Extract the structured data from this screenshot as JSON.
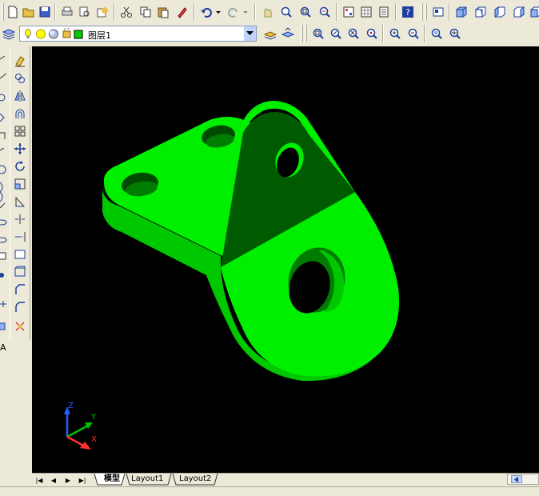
{
  "toolbar_standard": {
    "icons": [
      "new-icon",
      "open-icon",
      "save-icon",
      "plot-icon",
      "plot-preview-icon",
      "publish-icon",
      "cut-icon",
      "copy-icon",
      "paste-icon",
      "match-properties-icon",
      "undo-icon",
      "redo-icon",
      "pan-realtime-icon",
      "zoom-realtime-icon",
      "zoom-window-icon",
      "zoom-previous-icon",
      "properties-icon",
      "design-center-icon",
      "tool-palettes-icon",
      "help-icon"
    ]
  },
  "toolbar_view": {
    "icons": [
      "named-views-icon",
      "top-view-icon",
      "bottom-view-icon",
      "left-view-icon",
      "right-view-icon",
      "front-view-icon"
    ]
  },
  "layers": {
    "current_layer": "图层1",
    "colors": {
      "bulb": "#ffff00",
      "sun": "#ffff00",
      "swatch": "#00cc00"
    }
  },
  "toolbar_zoom": {
    "icons": [
      "zoom-window-icon",
      "zoom-dynamic-icon",
      "zoom-scale-icon",
      "zoom-center-icon",
      "zoom-in-icon",
      "zoom-out-icon",
      "zoom-all-icon",
      "zoom-extents-icon"
    ]
  },
  "toolbar_modify": {
    "icons": [
      "erase-icon",
      "copy-object-icon",
      "mirror-icon",
      "offset-icon",
      "array-icon",
      "move-icon",
      "rotate-icon",
      "scale-icon",
      "stretch-icon",
      "trim-icon",
      "extend-icon",
      "break-icon",
      "join-icon",
      "chamfer-icon",
      "fillet-icon",
      "explode-icon"
    ]
  },
  "ucs": {
    "z": "Z",
    "y": "Y",
    "x": "X"
  },
  "tabs": {
    "model": "模型",
    "layout1": "Layout1",
    "layout2": "Layout2"
  },
  "model": {
    "colors": {
      "bright": "#00ee00",
      "mid": "#00c800",
      "dark": "#007d00",
      "darker": "#005a00"
    }
  }
}
